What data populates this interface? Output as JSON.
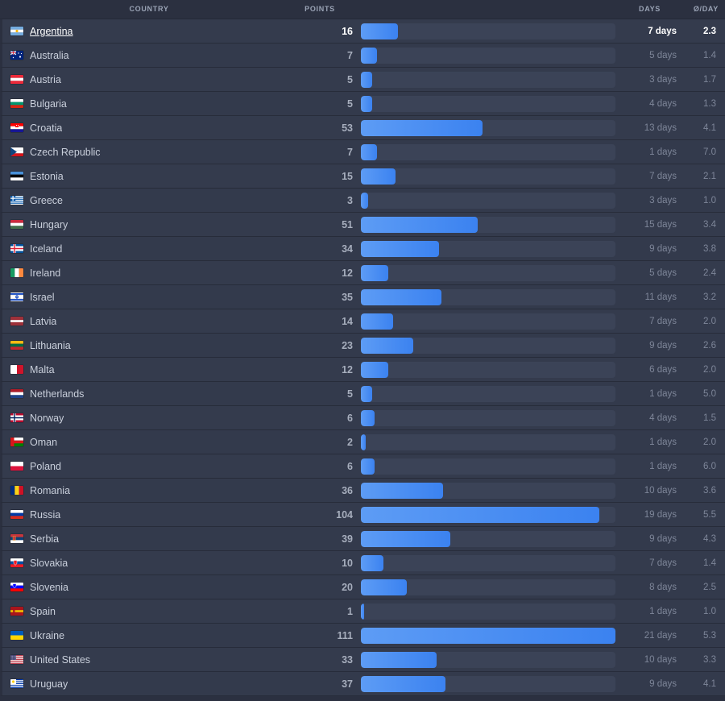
{
  "table": {
    "columns": {
      "country": "COUNTRY",
      "points": "POINTS",
      "days": "DAYS",
      "avg_per_day": "Ø/DAY"
    },
    "max_points": 111,
    "bar_color_start": "#5d9cf5",
    "bar_color_end": "#3b82f0",
    "track_color": "#3b4357",
    "row_color": "#343b4d",
    "background_color": "#2b3040",
    "rows": [
      {
        "country": "Argentina",
        "flag": "flag-argentina",
        "points": 16,
        "days": "7 days",
        "avg": "2.3",
        "active": true
      },
      {
        "country": "Australia",
        "flag": "flag-australia",
        "points": 7,
        "days": "5 days",
        "avg": "1.4",
        "active": false
      },
      {
        "country": "Austria",
        "flag": "flag-austria",
        "points": 5,
        "days": "3 days",
        "avg": "1.7",
        "active": false
      },
      {
        "country": "Bulgaria",
        "flag": "flag-bulgaria",
        "points": 5,
        "days": "4 days",
        "avg": "1.3",
        "active": false
      },
      {
        "country": "Croatia",
        "flag": "flag-croatia",
        "points": 53,
        "days": "13 days",
        "avg": "4.1",
        "active": false
      },
      {
        "country": "Czech Republic",
        "flag": "flag-czech-republic",
        "points": 7,
        "days": "1 days",
        "avg": "7.0",
        "active": false
      },
      {
        "country": "Estonia",
        "flag": "flag-estonia",
        "points": 15,
        "days": "7 days",
        "avg": "2.1",
        "active": false
      },
      {
        "country": "Greece",
        "flag": "flag-greece",
        "points": 3,
        "days": "3 days",
        "avg": "1.0",
        "active": false
      },
      {
        "country": "Hungary",
        "flag": "flag-hungary",
        "points": 51,
        "days": "15 days",
        "avg": "3.4",
        "active": false
      },
      {
        "country": "Iceland",
        "flag": "flag-iceland",
        "points": 34,
        "days": "9 days",
        "avg": "3.8",
        "active": false
      },
      {
        "country": "Ireland",
        "flag": "flag-ireland",
        "points": 12,
        "days": "5 days",
        "avg": "2.4",
        "active": false
      },
      {
        "country": "Israel",
        "flag": "flag-israel",
        "points": 35,
        "days": "11 days",
        "avg": "3.2",
        "active": false
      },
      {
        "country": "Latvia",
        "flag": "flag-latvia",
        "points": 14,
        "days": "7 days",
        "avg": "2.0",
        "active": false
      },
      {
        "country": "Lithuania",
        "flag": "flag-lithuania",
        "points": 23,
        "days": "9 days",
        "avg": "2.6",
        "active": false
      },
      {
        "country": "Malta",
        "flag": "flag-malta",
        "points": 12,
        "days": "6 days",
        "avg": "2.0",
        "active": false
      },
      {
        "country": "Netherlands",
        "flag": "flag-netherlands",
        "points": 5,
        "days": "1 days",
        "avg": "5.0",
        "active": false
      },
      {
        "country": "Norway",
        "flag": "flag-norway",
        "points": 6,
        "days": "4 days",
        "avg": "1.5",
        "active": false
      },
      {
        "country": "Oman",
        "flag": "flag-oman",
        "points": 2,
        "days": "1 days",
        "avg": "2.0",
        "active": false
      },
      {
        "country": "Poland",
        "flag": "flag-poland",
        "points": 6,
        "days": "1 days",
        "avg": "6.0",
        "active": false
      },
      {
        "country": "Romania",
        "flag": "flag-romania",
        "points": 36,
        "days": "10 days",
        "avg": "3.6",
        "active": false
      },
      {
        "country": "Russia",
        "flag": "flag-russia",
        "points": 104,
        "days": "19 days",
        "avg": "5.5",
        "active": false
      },
      {
        "country": "Serbia",
        "flag": "flag-serbia",
        "points": 39,
        "days": "9 days",
        "avg": "4.3",
        "active": false
      },
      {
        "country": "Slovakia",
        "flag": "flag-slovakia",
        "points": 10,
        "days": "7 days",
        "avg": "1.4",
        "active": false
      },
      {
        "country": "Slovenia",
        "flag": "flag-slovenia",
        "points": 20,
        "days": "8 days",
        "avg": "2.5",
        "active": false
      },
      {
        "country": "Spain",
        "flag": "flag-spain",
        "points": 1,
        "days": "1 days",
        "avg": "1.0",
        "active": false
      },
      {
        "country": "Ukraine",
        "flag": "flag-ukraine",
        "points": 111,
        "days": "21 days",
        "avg": "5.3",
        "active": false
      },
      {
        "country": "United States",
        "flag": "flag-united-states",
        "points": 33,
        "days": "10 days",
        "avg": "3.3",
        "active": false
      },
      {
        "country": "Uruguay",
        "flag": "flag-uruguay",
        "points": 37,
        "days": "9 days",
        "avg": "4.1",
        "active": false
      }
    ]
  }
}
